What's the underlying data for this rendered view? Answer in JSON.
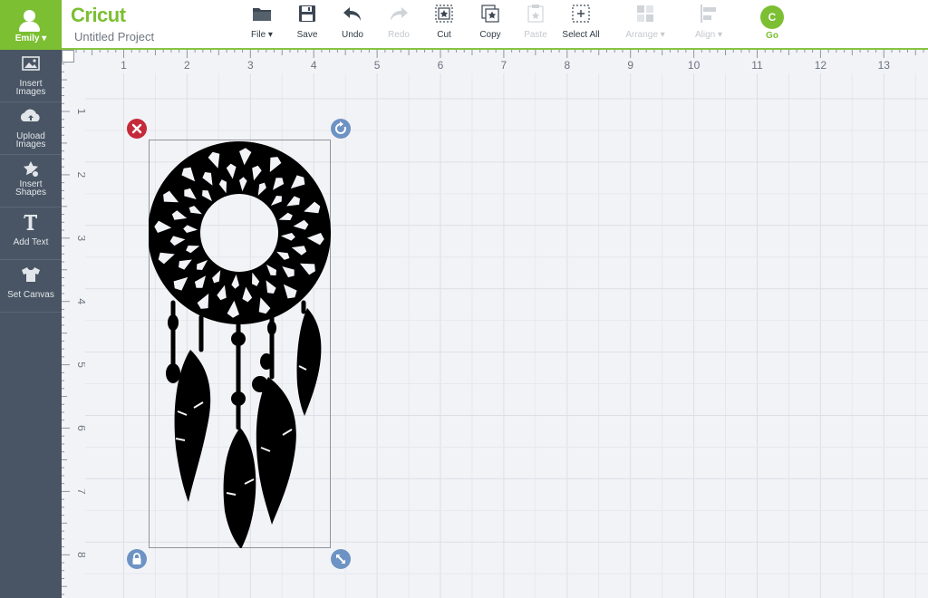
{
  "user": {
    "name": "Emily ▾"
  },
  "app": {
    "logo": "Cricut",
    "project_title": "Untitled Project"
  },
  "toolbar": {
    "file": "File ▾",
    "save": "Save",
    "undo": "Undo",
    "redo": "Redo",
    "cut": "Cut",
    "copy": "Copy",
    "paste": "Paste",
    "select_all": "Select All",
    "arrange": "Arrange ▾",
    "align": "Align ▾",
    "go": "Go",
    "go_badge": "C"
  },
  "sidebar": {
    "items": [
      {
        "line1": "Insert",
        "line2": "Images",
        "icon": "image-icon"
      },
      {
        "line1": "Upload",
        "line2": "Images",
        "icon": "cloud-upload-icon"
      },
      {
        "line1": "Insert",
        "line2": "Shapes",
        "icon": "shapes-icon"
      },
      {
        "line1": "Add Text",
        "line2": "",
        "icon": "text-t-icon"
      },
      {
        "line1": "Set Canvas",
        "line2": "",
        "icon": "tshirt-icon"
      }
    ]
  },
  "rulers": {
    "horizontal": [
      "1",
      "2",
      "3",
      "4",
      "5",
      "6",
      "7",
      "8",
      "9",
      "10",
      "11",
      "12",
      "13"
    ],
    "vertical": [
      "1",
      "2",
      "3",
      "4",
      "5",
      "6",
      "7",
      "8"
    ]
  },
  "colors": {
    "brand_green": "#7cbf33",
    "sidebar": "#495564",
    "delete_handle": "#c52a3a",
    "handle_blue": "#6d93c4",
    "canvas_bg": "#f2f3f7"
  }
}
